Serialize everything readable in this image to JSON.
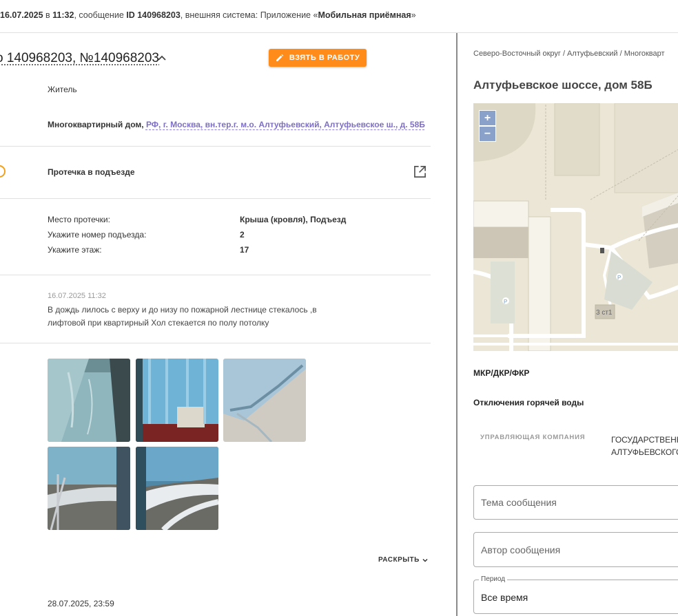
{
  "topbar": {
    "date": "16.07.2025",
    "sep_in": " в ",
    "time": "11:32",
    "msg_prefix": ", сообщение ",
    "id_text": "ID 140968203",
    "system_text": ", внешняя система: Приложение «",
    "system_name": "Мобильная приёмная",
    "system_end": "»"
  },
  "left": {
    "title": "о 140968203, №140968203",
    "take_button": "ВЗЯТЬ В РАБОТУ",
    "author_type": "Житель",
    "object_type": "Многоквартирный дом, ",
    "object_address": "РФ, г. Москва, вн.тер.г. м.о. Алтуфьевский, Алтуфьевское ш., д. 58Б",
    "problem": "Протечка в подъезде",
    "details": [
      {
        "label": "Место протечки:",
        "value": "Крыша (кровля), Подъезд"
      },
      {
        "label": "Укажите номер подъезда:",
        "value": "2"
      },
      {
        "label": "Укажите этаж:",
        "value": "17"
      }
    ],
    "comment_date": "16.07.2025 11:32",
    "comment_text_1": "В дождь лилось с верху и до низу по пожарной лестнице стекалось ,в",
    "comment_text_2": "лифтовой при квартирный Хол стекается по полу потолку",
    "expand_label": "РАСКРЫТЬ",
    "bottom_date": "28.07.2025, 23:59"
  },
  "right": {
    "breadcrumb": "Северо-Восточный округ / Алтуфьевский / Многокварт",
    "address": "Алтуфьевское шоссе, дом 58Б",
    "map": {
      "zoom_in": "+",
      "zoom_out": "−",
      "building_label": "3 ст1",
      "parking_label": "P"
    },
    "repair_label": "МКР/ДКР/ФКР",
    "hot_water_label": "Отключения горячей воды",
    "uk_label": "УПРАВЛЯЮЩАЯ КОМПАНИЯ",
    "uk_value_1": "ГОСУДАРСТВЕНН",
    "uk_value_2": "АЛТУФЬЕВСКОГО",
    "topic_placeholder": "Тема сообщения",
    "author_placeholder": "Автор сообщения",
    "period_legend": "Период",
    "period_value": "Все время"
  }
}
